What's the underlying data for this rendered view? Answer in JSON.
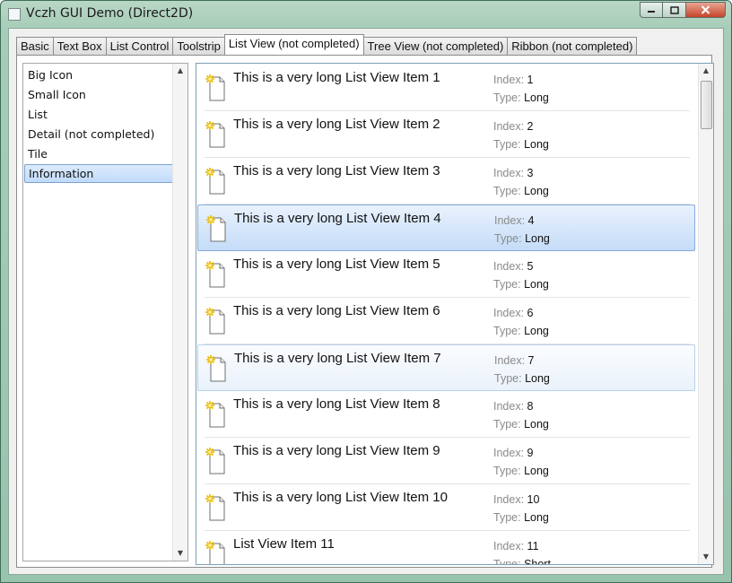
{
  "window": {
    "title": "Vczh GUI Demo (Direct2D)"
  },
  "tabs": [
    {
      "label": "Basic"
    },
    {
      "label": "Text Box"
    },
    {
      "label": "List Control"
    },
    {
      "label": "Toolstrip"
    },
    {
      "label": "List View (not completed)",
      "active": true
    },
    {
      "label": "Tree View (not completed)"
    },
    {
      "label": "Ribbon (not completed)"
    }
  ],
  "view_modes": [
    {
      "label": "Big Icon"
    },
    {
      "label": "Small Icon"
    },
    {
      "label": "List"
    },
    {
      "label": "Detail (not completed)"
    },
    {
      "label": "Tile"
    },
    {
      "label": "Information",
      "selected": true
    }
  ],
  "list_view": {
    "index_key": "Index:",
    "type_key": "Type:",
    "items": [
      {
        "text": "This is a very long List View Item 1",
        "index": "1",
        "type": "Long"
      },
      {
        "text": "This is a very long List View Item 2",
        "index": "2",
        "type": "Long"
      },
      {
        "text": "This is a very long List View Item 3",
        "index": "3",
        "type": "Long"
      },
      {
        "text": "This is a very long List View Item 4",
        "index": "4",
        "type": "Long",
        "state": "selected"
      },
      {
        "text": "This is a very long List View Item 5",
        "index": "5",
        "type": "Long"
      },
      {
        "text": "This is a very long List View Item 6",
        "index": "6",
        "type": "Long"
      },
      {
        "text": "This is a very long List View Item 7",
        "index": "7",
        "type": "Long",
        "state": "hover"
      },
      {
        "text": "This is a very long List View Item 8",
        "index": "8",
        "type": "Long"
      },
      {
        "text": "This is a very long List View Item 9",
        "index": "9",
        "type": "Long"
      },
      {
        "text": "This is a very long List View Item 10",
        "index": "10",
        "type": "Long"
      },
      {
        "text": "List View Item 11",
        "index": "11",
        "type": "Short"
      }
    ]
  },
  "colors": {
    "selection": "#c5dcf8",
    "selection_border": "#84acdd",
    "hover": "#eaf2fb",
    "frame": "#a7cdb8"
  }
}
